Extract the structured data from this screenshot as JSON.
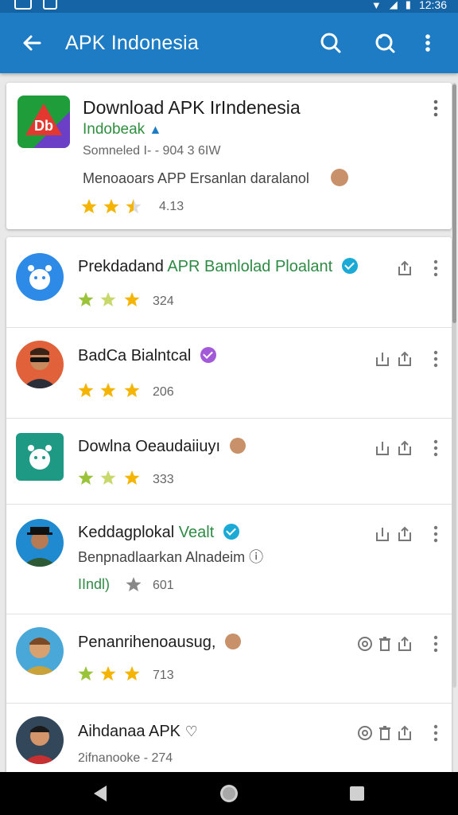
{
  "status": {
    "time": "12:36"
  },
  "appbar": {
    "title": "APK Indonesia",
    "icons": [
      "back-arrow-icon",
      "search-icon",
      "refresh-search-icon",
      "more-vert-icon"
    ]
  },
  "featured": {
    "title": "Download APK IrIndenesia",
    "developer": "Indobeak",
    "meta": "Somneled I‐ - 904 3 6IW",
    "description": "Menoaoars APP Ersanlan daralanol",
    "rating": "4.13",
    "stars": 2.5
  },
  "list": [
    {
      "name": "Prekdadand",
      "dev": "APR Bamlolad Ploalant",
      "verified": "#1ba9d6",
      "rating": "324",
      "stars": 3
    },
    {
      "name": "BadCa Bialntcal",
      "verified": "#a35ad8",
      "rating": "206",
      "stars": 3
    },
    {
      "name": "Dowlna Oeaudaiiuyı",
      "rating": "333",
      "stars": 3
    },
    {
      "name": "Keddagplokal",
      "dev": "Vealt",
      "verified": "#1ba9d6",
      "sub": "Benpnadlaarkan Alnadeim",
      "rating": "601",
      "prefix": "IIndl)"
    },
    {
      "name": "Penanrihenoausug,",
      "rating": "713",
      "stars": 3
    },
    {
      "name": "Aihdanaa APK",
      "sub": "2ifnanooke - 274",
      "rating": ""
    }
  ],
  "colors": {
    "appbar": "#1e7cc5",
    "statusbar": "#1565a6",
    "accent_green": "#2e8b45",
    "star": "#f4b400"
  }
}
